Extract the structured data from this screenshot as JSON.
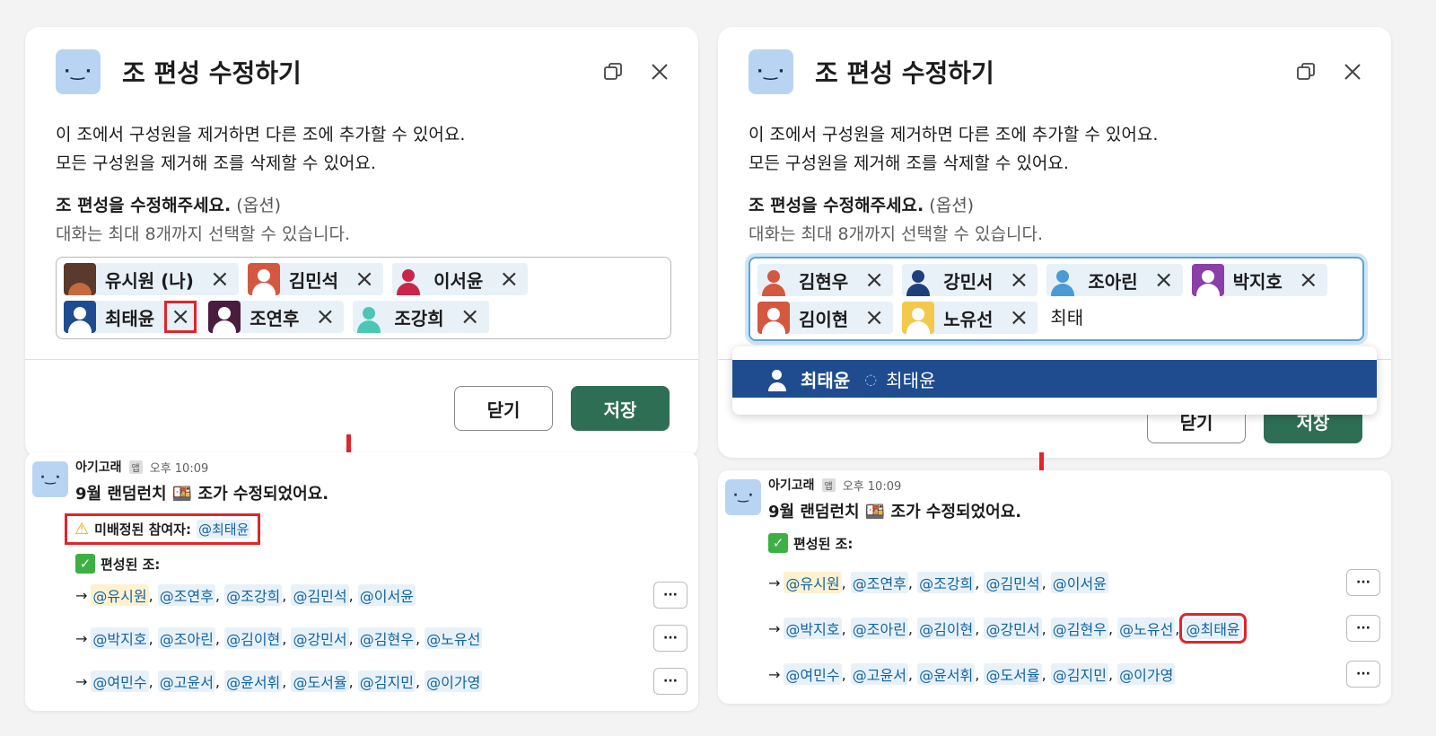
{
  "modal": {
    "face": "·‿·",
    "title": "조 편성 수정하기",
    "desc_line1": "이 조에서 구성원을 제거하면 다른 조에 추가할 수 있어요.",
    "desc_line2": "모든 구성원을 제거해 조를 삭제할 수 있어요.",
    "label": "조 편성을 수정해주세요.",
    "label_optional": "(옵션)",
    "hint": "대화는 최대 8개까지 선택할 수 있습니다.",
    "close_label": "닫기",
    "save_label": "저장",
    "remove_icon": "×"
  },
  "left": {
    "chips": [
      "유시원 (나)",
      "김민석",
      "이서윤",
      "최태윤",
      "조연후",
      "조강희"
    ]
  },
  "right": {
    "chips": [
      "김현우",
      "강민서",
      "조아린",
      "박지호",
      "김이현",
      "노유선"
    ],
    "typed": "최태",
    "dropdown": {
      "name": "최태윤",
      "alt": "최태윤"
    }
  },
  "colors": {
    "save": "#2e6e55",
    "highlight": "#e0252b",
    "mention": "#1264a3",
    "dropdown_active": "#1f4c8f"
  },
  "message": {
    "face": "·‿·",
    "sender": "아기고래",
    "app_badge": "앱",
    "time": "오후 10:09",
    "title": "9월 랜덤런치 🍱 조가 수정되었어요.",
    "unassigned_label": "미배정된 참여자:",
    "unassigned_mention": "@최태윤",
    "grouped_label": "편성된 조:",
    "more": "···",
    "left_groups": [
      [
        "@유시원",
        "@조연후",
        "@조강희",
        "@김민석",
        "@이서윤"
      ],
      [
        "@박지호",
        "@조아린",
        "@김이현",
        "@강민서",
        "@김현우",
        "@노유선"
      ],
      [
        "@여민수",
        "@고윤서",
        "@윤서휘",
        "@도서율",
        "@김지민",
        "@이가영"
      ]
    ],
    "right_groups": [
      [
        "@유시원",
        "@조연후",
        "@조강희",
        "@김민석",
        "@이서윤"
      ],
      [
        "@박지호",
        "@조아린",
        "@김이현",
        "@강민서",
        "@김현우",
        "@노유선",
        "@최태윤"
      ],
      [
        "@여민수",
        "@고윤서",
        "@윤서휘",
        "@도서율",
        "@김지민",
        "@이가영"
      ]
    ]
  }
}
